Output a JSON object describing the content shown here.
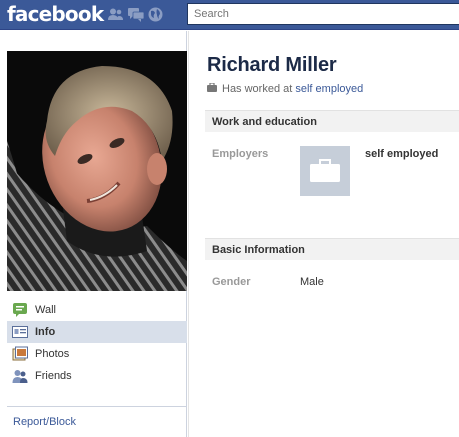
{
  "topbar": {
    "logo": "facebook",
    "search_placeholder": "Search"
  },
  "profile": {
    "name": "Richard Miller",
    "worked_prefix": "Has worked at",
    "worked_company": "self employed"
  },
  "nav": {
    "items": [
      {
        "label": "Wall",
        "icon": "wall-icon"
      },
      {
        "label": "Info",
        "icon": "info-icon",
        "active": true
      },
      {
        "label": "Photos",
        "icon": "photos-icon"
      },
      {
        "label": "Friends",
        "icon": "friends-icon"
      }
    ],
    "report_block": "Report/Block"
  },
  "work": {
    "header": "Work and education",
    "employers_label": "Employers",
    "employer_name": "self employed"
  },
  "basic": {
    "header": "Basic Information",
    "gender_label": "Gender",
    "gender_value": "Male"
  },
  "colors": {
    "brand": "#3b5998",
    "name": "#1c2a47",
    "nav_active": "#d8dfea"
  }
}
